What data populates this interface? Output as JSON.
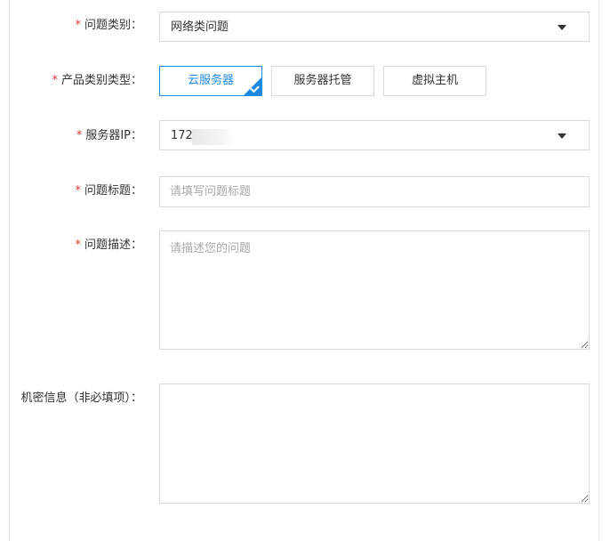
{
  "form": {
    "required_mark": "*",
    "category": {
      "label": "问题类别：",
      "value": "网络类问题"
    },
    "product_type": {
      "label": "产品类别类型：",
      "options": [
        "云服务器",
        "服务器托管",
        "虚拟主机"
      ],
      "selected": "云服务器"
    },
    "server_ip": {
      "label": "服务器IP：",
      "value": "172."
    },
    "title": {
      "label": "问题标题：",
      "placeholder": "请填写问题标题"
    },
    "description": {
      "label": "问题描述：",
      "placeholder": "请描述您的问题"
    },
    "confidential": {
      "label": "机密信息（非必填项）："
    }
  },
  "colors": {
    "accent": "#1e88e5",
    "required": "#e0363a",
    "border": "#d9d9d9"
  },
  "icons": [
    "caret-down-icon",
    "check-corner-icon"
  ]
}
